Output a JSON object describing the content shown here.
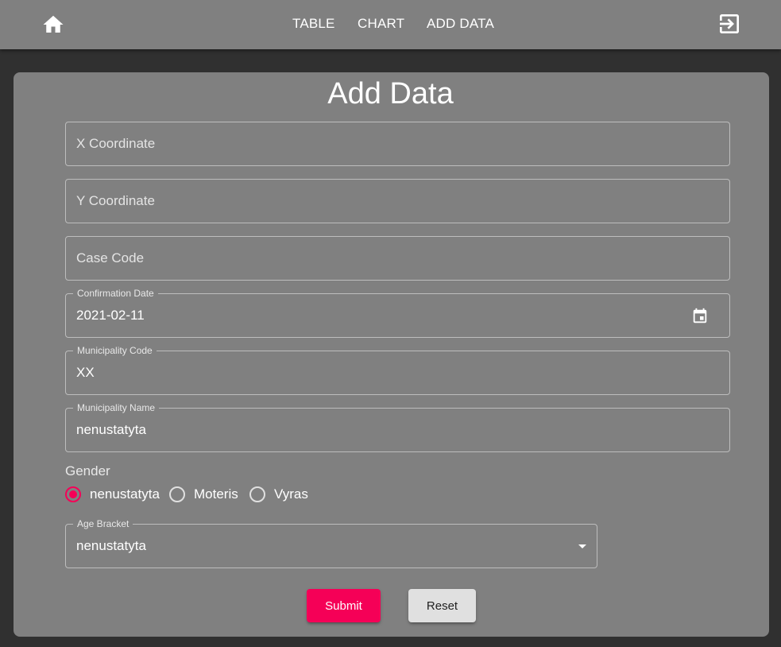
{
  "nav": {
    "home_icon": "home-icon",
    "links": [
      "TABLE",
      "CHART",
      "ADD DATA"
    ],
    "logout_icon": "exit-to-app-icon"
  },
  "form": {
    "title": "Add Data",
    "x_coordinate": {
      "placeholder": "X Coordinate",
      "value": ""
    },
    "y_coordinate": {
      "placeholder": "Y Coordinate",
      "value": ""
    },
    "case_code": {
      "placeholder": "Case Code",
      "value": ""
    },
    "confirmation_date": {
      "label": "Confirmation Date",
      "value": "2021-02-11",
      "icon": "calendar-icon"
    },
    "municipality_code": {
      "label": "Municipality Code",
      "value": "XX"
    },
    "municipality_name": {
      "label": "Municipality Name",
      "value": "nenustatyta"
    },
    "gender": {
      "legend": "Gender",
      "options": [
        "nenustatyta",
        "Moteris",
        "Vyras"
      ],
      "selected": "nenustatyta"
    },
    "age_bracket": {
      "label": "Age Bracket",
      "value": "nenustatyta"
    },
    "submit_label": "Submit",
    "reset_label": "Reset"
  },
  "colors": {
    "appbar": "#808080",
    "background": "#303030",
    "card": "#808080",
    "accent": "#f50057",
    "reset_button": "#e0e0e0"
  }
}
